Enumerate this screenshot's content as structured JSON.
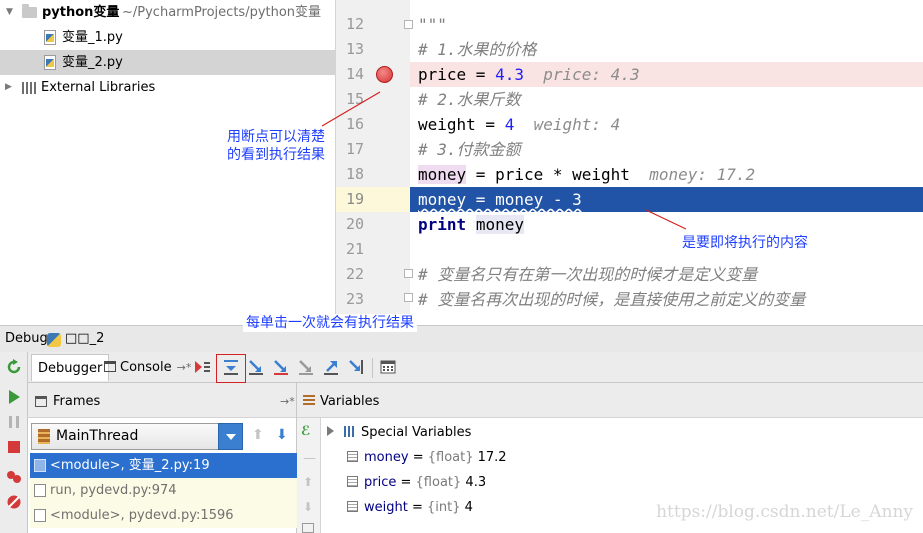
{
  "project": {
    "root_name": "python变量",
    "root_path": "~/PycharmProjects/python变量",
    "files": [
      "变量_1.py",
      "变量_2.py"
    ],
    "selected_file": "变量_2.py",
    "external": "External Libraries"
  },
  "editor": {
    "lines": [
      {
        "num": "12",
        "text": "\"\"\""
      },
      {
        "num": "13",
        "text": "# 1.水果的价格"
      },
      {
        "num": "14",
        "var": "price",
        "op": " = ",
        "value": "4.3",
        "inline": "price: 4.3"
      },
      {
        "num": "15",
        "text": "# 2.水果斤数"
      },
      {
        "num": "16",
        "var": "weight",
        "op": " = ",
        "value": "4",
        "inline": "weight: 4"
      },
      {
        "num": "17",
        "text": "# 3.付款金额"
      },
      {
        "num": "18",
        "var": "money",
        "op": " = price * weight",
        "inline": "money: 17.2"
      },
      {
        "num": "19",
        "text": "money = money - 3"
      },
      {
        "num": "20",
        "kw": "print",
        "arg": "money"
      },
      {
        "num": "21"
      },
      {
        "num": "22",
        "text": "# 变量名只有在第一次出现的时候才是定义变量"
      },
      {
        "num": "23",
        "text": "# 变量名再次出现的时候，是直接使用之前定义的变量"
      }
    ],
    "breakpoint_line": "14",
    "current_line": "19"
  },
  "debug": {
    "title": "Debug",
    "config": "□□_2",
    "tabs": [
      "Debugger",
      "Console"
    ],
    "frames_header": "Frames",
    "variables_header": "Variables",
    "thread": "MainThread",
    "frames": [
      "<module>, 变量_2.py:19",
      "run, pydevd.py:974",
      "<module>, pydevd.py:1596"
    ],
    "special_vars": "Special Variables",
    "variables": [
      {
        "name": "money",
        "type": "{float}",
        "value": "17.2"
      },
      {
        "name": "price",
        "type": "{float}",
        "value": "4.3"
      },
      {
        "name": "weight",
        "type": "{int}",
        "value": "4"
      }
    ]
  },
  "annotations": {
    "breakpoint_note": [
      "用断点可以清楚",
      "的看到执行结果"
    ],
    "current_line_note": "是要即将执行的内容",
    "step_note": "每单击一次就会有执行结果",
    "color": "#1f3fff"
  },
  "watermark": "https://blog.csdn.net/Le_Anny",
  "colors": {
    "current_line": "#2153a6",
    "breakpoint_line": "#fae3e3",
    "breakpoint": "#d63232",
    "selected_frame": "#2b6fcf"
  }
}
